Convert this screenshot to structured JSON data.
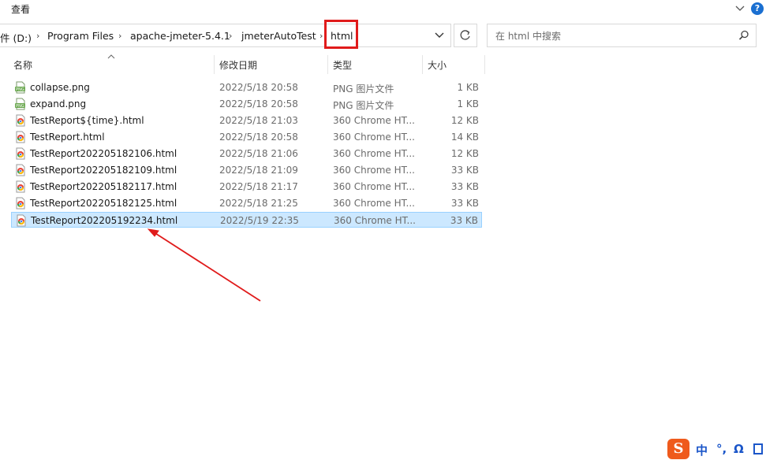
{
  "ribbon": {
    "view_tab": "查看"
  },
  "address": {
    "crumbs": [
      "件 (D:)",
      "Program Files",
      "apache-jmeter-5.4.1",
      "jmeterAutoTest",
      "html"
    ]
  },
  "search": {
    "placeholder": "在 html 中搜索"
  },
  "columns": {
    "name": "名称",
    "date": "修改日期",
    "type": "类型",
    "size": "大小"
  },
  "files": [
    {
      "name": "collapse.png",
      "date": "2022/5/18 20:58",
      "type": "PNG 图片文件",
      "size": "1 KB",
      "icon": "png-file-icon"
    },
    {
      "name": "expand.png",
      "date": "2022/5/18 20:58",
      "type": "PNG 图片文件",
      "size": "1 KB",
      "icon": "png-file-icon"
    },
    {
      "name": "TestReport${time}.html",
      "date": "2022/5/18 21:03",
      "type": "360 Chrome HT...",
      "size": "12 KB",
      "icon": "chrome-html-icon"
    },
    {
      "name": "TestReport.html",
      "date": "2022/5/18 20:58",
      "type": "360 Chrome HT...",
      "size": "14 KB",
      "icon": "chrome-html-icon"
    },
    {
      "name": "TestReport202205182106.html",
      "date": "2022/5/18 21:06",
      "type": "360 Chrome HT...",
      "size": "12 KB",
      "icon": "chrome-html-icon"
    },
    {
      "name": "TestReport202205182109.html",
      "date": "2022/5/18 21:09",
      "type": "360 Chrome HT...",
      "size": "33 KB",
      "icon": "chrome-html-icon"
    },
    {
      "name": "TestReport202205182117.html",
      "date": "2022/5/18 21:17",
      "type": "360 Chrome HT...",
      "size": "33 KB",
      "icon": "chrome-html-icon"
    },
    {
      "name": "TestReport202205182125.html",
      "date": "2022/5/18 21:25",
      "type": "360 Chrome HT...",
      "size": "33 KB",
      "icon": "chrome-html-icon"
    },
    {
      "name": "TestReport202205192234.html",
      "date": "2022/5/19 22:35",
      "type": "360 Chrome HT...",
      "size": "33 KB",
      "icon": "chrome-html-icon",
      "selected": true
    }
  ],
  "ime": {
    "logo": "S",
    "mode": "中",
    "punct": "°,",
    "symbol": "Ω"
  },
  "colors": {
    "selection": "#cce8ff",
    "annotation_red": "#e01b1b",
    "help_blue": "#1a6fd1"
  }
}
